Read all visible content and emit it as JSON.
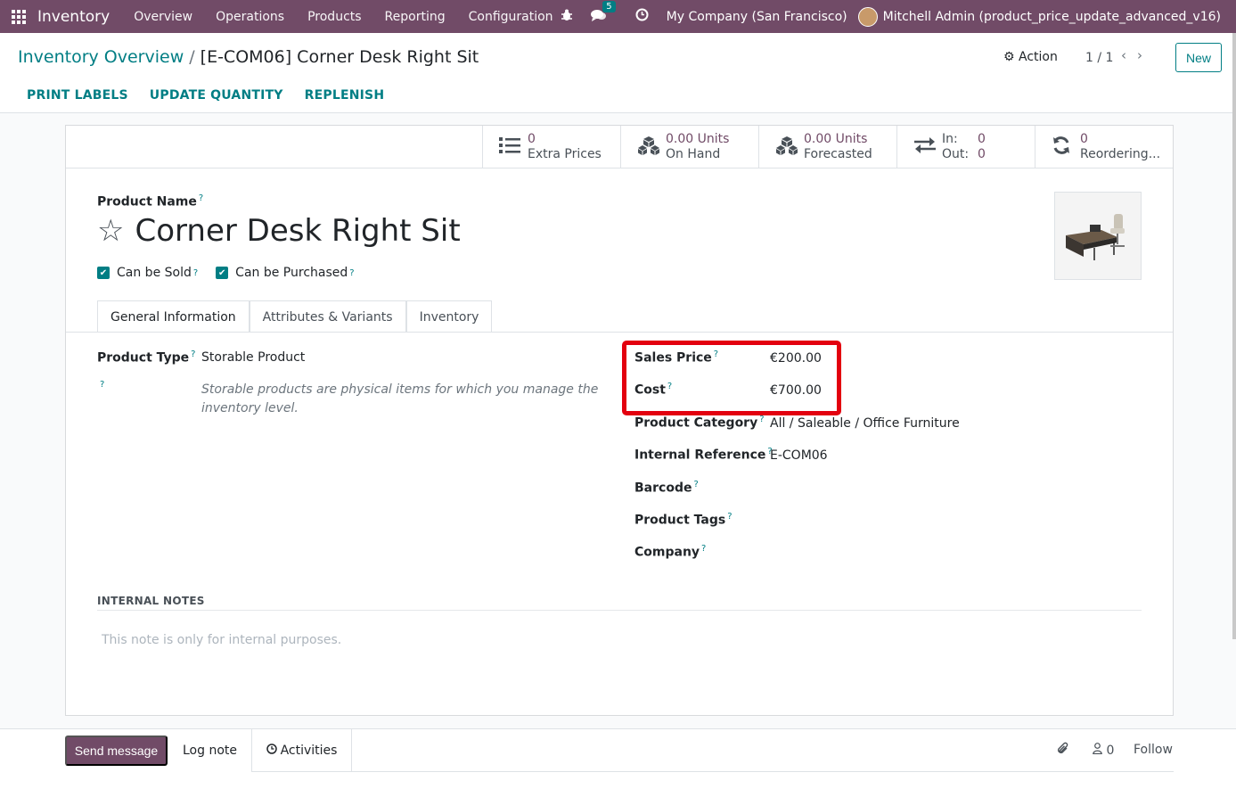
{
  "navbar": {
    "app_name": "Inventory",
    "menus": [
      "Overview",
      "Operations",
      "Products",
      "Reporting",
      "Configuration"
    ],
    "messages_count": "5",
    "company": "My Company (San Francisco)",
    "user": "Mitchell Admin (product_price_update_advanced_v16)"
  },
  "breadcrumb": {
    "parent": "Inventory Overview",
    "separator": "/",
    "current": "[E-COM06] Corner Desk Right Sit"
  },
  "control": {
    "action_label": "⚙ Action",
    "pager": "1 / 1",
    "new_label": "New"
  },
  "statusbar": {
    "buttons": [
      "PRINT LABELS",
      "UPDATE QUANTITY",
      "REPLENISH"
    ]
  },
  "smart_buttons": {
    "extra_prices": {
      "value": "0",
      "label": "Extra Prices"
    },
    "on_hand": {
      "value": "0.00 Units",
      "label": "On Hand"
    },
    "forecasted": {
      "value": "0.00 Units",
      "label": "Forecasted"
    },
    "in_out": {
      "in_label": "In:",
      "in_value": "0",
      "out_label": "Out:",
      "out_value": "0"
    },
    "reordering": {
      "value": "0",
      "label": "Reordering..."
    }
  },
  "product": {
    "name_label": "Product Name",
    "name": "Corner Desk Right Sit",
    "can_be_sold": "Can be Sold",
    "can_be_purchased": "Can be Purchased"
  },
  "tabs": [
    "General Information",
    "Attributes & Variants",
    "Inventory"
  ],
  "general": {
    "product_type_label": "Product Type",
    "product_type": "Storable Product",
    "product_type_help": "Storable products are physical items for which you manage the inventory level.",
    "sales_price_label": "Sales Price",
    "sales_price": "€200.00",
    "cost_label": "Cost",
    "cost": "€700.00",
    "category_label": "Product Category",
    "category": "All / Saleable / Office Furniture",
    "internal_ref_label": "Internal Reference",
    "internal_ref": "E-COM06",
    "barcode_label": "Barcode",
    "tags_label": "Product Tags",
    "company_label": "Company"
  },
  "notes": {
    "title": "INTERNAL NOTES",
    "placeholder": "This note is only for internal purposes."
  },
  "chatter": {
    "send_message": "Send message",
    "log_note": "Log note",
    "activities": "Activities",
    "followers_count": "0",
    "follow": "Follow"
  },
  "colors": {
    "brand": "#714b67",
    "accent": "#017e84",
    "highlight": "#e3000f"
  }
}
